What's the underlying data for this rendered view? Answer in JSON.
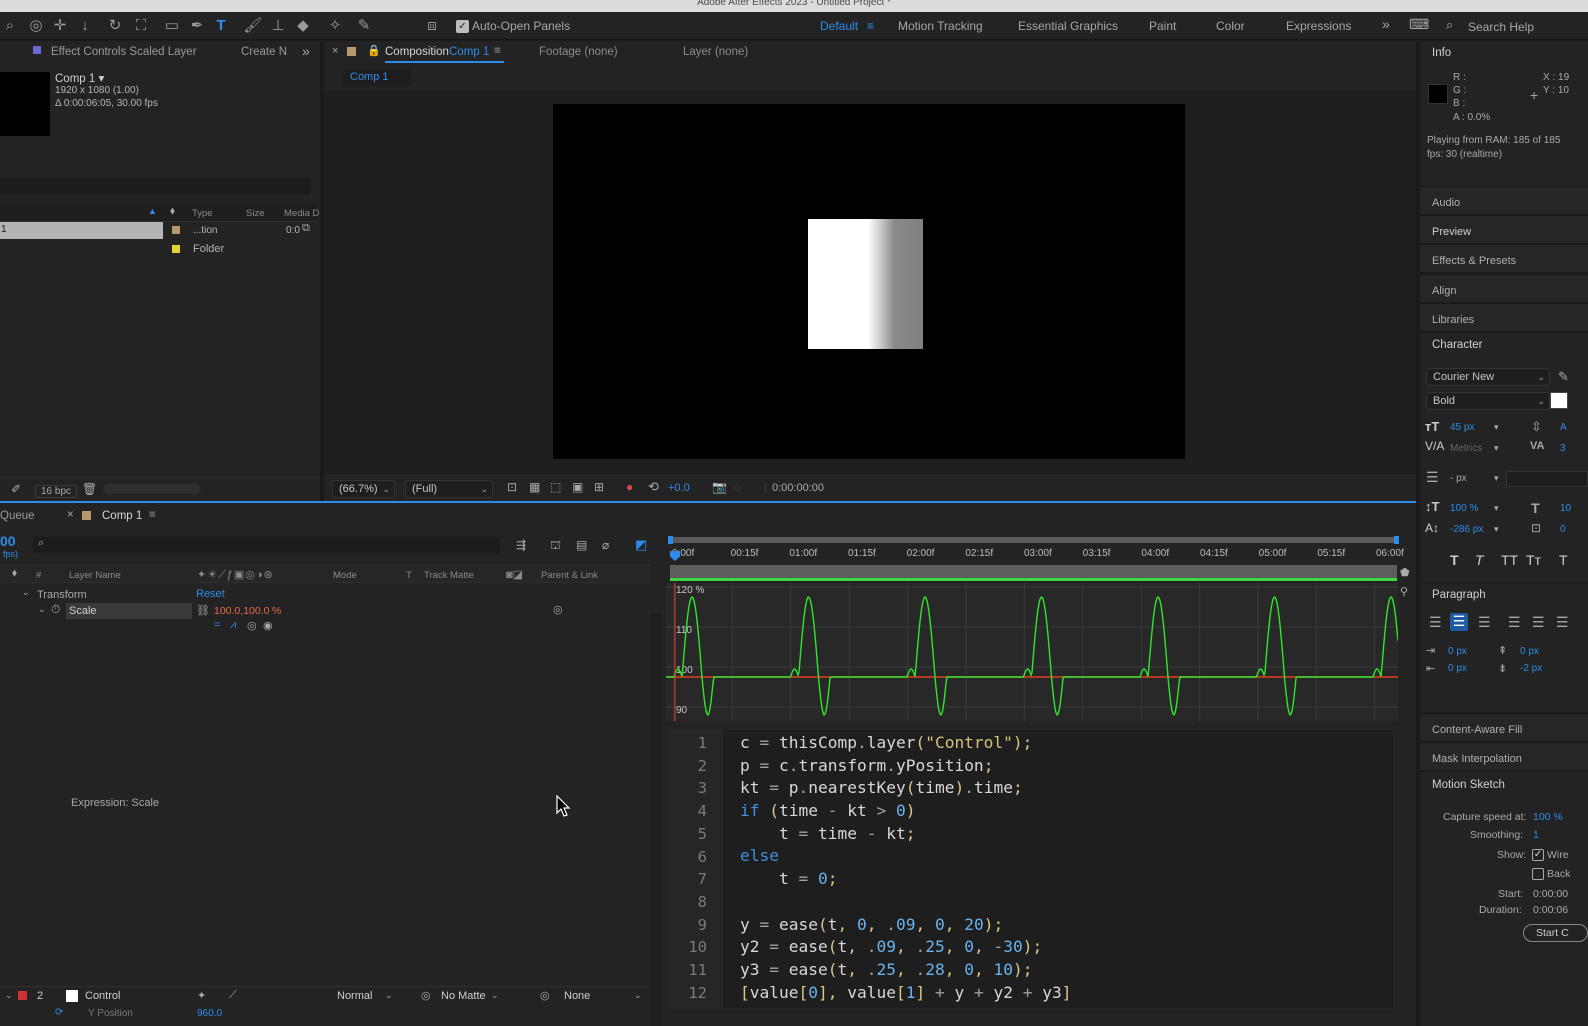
{
  "app": {
    "title": "Adobe After Effects 2023 - Untitled Project *"
  },
  "toolbar": {
    "auto_open_label": "Auto-Open Panels",
    "workspaces": [
      "Default",
      "Motion Tracking",
      "Essential Graphics",
      "Paint",
      "Color",
      "Expressions"
    ],
    "search_placeholder": "Search Help"
  },
  "project_panel": {
    "tab_label": "Effect Controls Scaled Layer",
    "create_label": "Create N",
    "comp_name": "Comp 1 ▾",
    "comp_res": "1920 x 1080 (1.00)",
    "comp_duration": "Δ 0:00:06:05, 30.00 fps",
    "columns": {
      "type": "Type",
      "size": "Size",
      "media": "Media D"
    },
    "rows": [
      {
        "name": "1",
        "type": "...tion",
        "extra": "0:0"
      },
      {
        "name": "",
        "type": "Folder",
        "extra": ""
      }
    ],
    "bpc": "16 bpc"
  },
  "comp_panel": {
    "tab_prefix": "Composition",
    "tab_name": "Comp 1",
    "footage_tab": "Footage (none)",
    "layer_tab": "Layer (none)",
    "subtab": "Comp 1",
    "zoom": "(66.7%)",
    "resolution": "(Full)",
    "exposure": "+0.0",
    "timecode": "0:00:00:00"
  },
  "timeline": {
    "queue_tab": "Queue",
    "tab": "Comp 1",
    "time_partial": "00",
    "fps_partial": "fps)",
    "columns": {
      "layer_name": "Layer Name",
      "mode": "Mode",
      "t": "T",
      "track_matte": "Track Matte",
      "parent": "Parent & Link"
    },
    "transform_label": "Transform",
    "reset_label": "Reset",
    "scale_label": "Scale",
    "scale_value": "100.0,100.0",
    "scale_pct": "%",
    "expression_label": "Expression: Scale",
    "control_layer": {
      "num": "2",
      "name": "Control",
      "mode": "Normal",
      "matte": "No Matte",
      "parent": "None"
    },
    "next_prop": "Y Position",
    "next_value": "960.0",
    "ruler_ticks": [
      "0:00f",
      "00:15f",
      "01:00f",
      "01:15f",
      "02:00f",
      "02:15f",
      "03:00f",
      "03:15f",
      "04:00f",
      "04:15f",
      "05:00f",
      "05:15f",
      "06:00f"
    ],
    "graph_labels": [
      "120 %",
      "110",
      "100",
      "90"
    ]
  },
  "code_lines": [
    "c = thisComp.layer(\"Control\");",
    "p = c.transform.yPosition;",
    "kt = p.nearestKey(time).time;",
    "if (time - kt > 0)",
    "    t = time - kt;",
    "else",
    "    t = 0;",
    "",
    "y = ease(t, 0, .09, 0, 20);",
    "y2 = ease(t, .09, .25, 0, -30);",
    "y3 = ease(t, .25, .28, 0, 10);",
    "[value[0], value[1] + y + y2 + y3]"
  ],
  "line_numbers": [
    "1",
    "2",
    "3",
    "4",
    "5",
    "6",
    "7",
    "8",
    "9",
    "10",
    "11",
    "12"
  ],
  "info_panel": {
    "title": "Info",
    "r": "R :",
    "g": "G :",
    "b": "B :",
    "a": "A :  0.0%",
    "x": "X : 19",
    "y": "Y : 10",
    "ram": "Playing from RAM: 185 of 185",
    "fps": "fps: 30 (realtime)"
  },
  "side_tabs": [
    "Audio",
    "Preview",
    "Effects & Presets",
    "Align",
    "Libraries"
  ],
  "character": {
    "title": "Character",
    "font": "Courier New",
    "style": "Bold",
    "size": "45 px",
    "kerning": "Metrics",
    "leading": "- px",
    "vscale": "100 %",
    "baseline": "-286 px",
    "tracking_r": "3",
    "right_a": "A",
    "right_1": "10",
    "right_2": "0",
    "caps": [
      "T",
      "T",
      "TT",
      "Tт",
      "T"
    ]
  },
  "paragraph": {
    "title": "Paragraph",
    "indent_l": "0 px",
    "indent_r": "0 px",
    "indent_f": "0 px",
    "space_a": "-2 px"
  },
  "lower_tabs": [
    "Content-Aware Fill",
    "Mask Interpolation"
  ],
  "motion_sketch": {
    "title": "Motion Sketch",
    "capture_label": "Capture speed at:",
    "capture_value": "100 %",
    "smoothing_label": "Smoothing:",
    "smoothing_value": "1",
    "show_label": "Show:",
    "wire_label": "Wire",
    "back_label": "Back",
    "start_label": "Start:",
    "start_value": "0:00:00",
    "duration_label": "Duration:",
    "duration_value": "0:00:06",
    "start_button": "Start C"
  },
  "colors": {
    "accent": "#2d8ceb",
    "graph": "#2ee62e",
    "reference": "#e23c1e",
    "value": "#e86a4a"
  }
}
